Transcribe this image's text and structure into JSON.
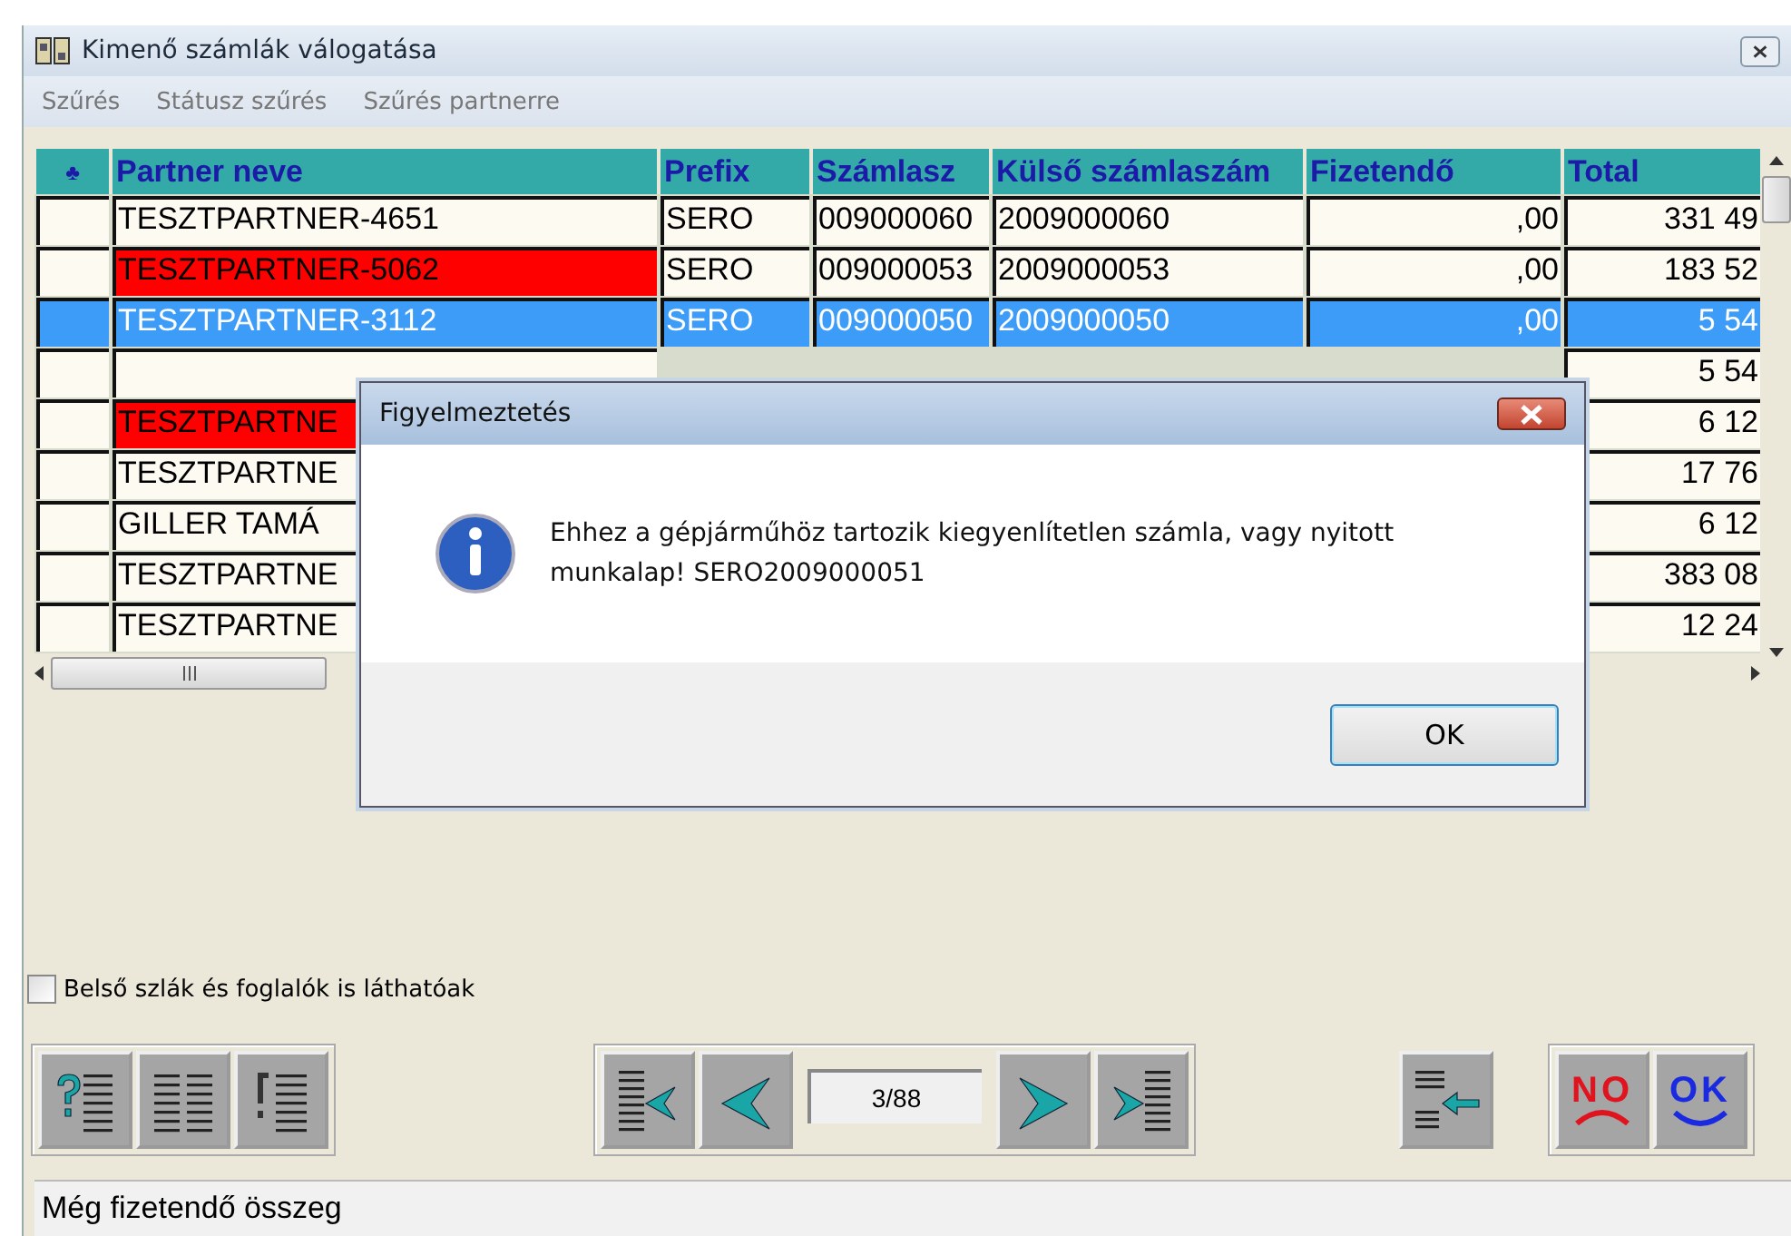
{
  "window": {
    "title": "Kimenő számlák válogatása"
  },
  "menu": [
    "Szűrés",
    "Státusz szűrés",
    "Szűrés partnerre"
  ],
  "table": {
    "columns": [
      "♣",
      "Partner neve",
      "Prefix",
      "Számlasz",
      "Külső számlaszám",
      "Fizetendő",
      "Total"
    ],
    "rows": [
      {
        "partner": "TESZTPARTNER-4651",
        "prefix": "SERO",
        "invoice_no": "009000060",
        "external_no": "2009000060",
        "payable": ",00",
        "total": "331 49",
        "flagged": false,
        "selected": false
      },
      {
        "partner": "TESZTPARTNER-5062",
        "prefix": "SERO",
        "invoice_no": "009000053",
        "external_no": "2009000053",
        "payable": ",00",
        "total": "183 52",
        "flagged": true,
        "selected": false
      },
      {
        "partner": "TESZTPARTNER-3112",
        "prefix": "SERO",
        "invoice_no": "009000050",
        "external_no": "2009000050",
        "payable": ",00",
        "total": "5 54",
        "flagged": false,
        "selected": true
      },
      {
        "total": "5 54",
        "flagged": false,
        "selected": false
      },
      {
        "partner": "TESZTPARTNE",
        "total": "6 12",
        "flagged": true,
        "selected": false
      },
      {
        "partner": "TESZTPARTNE",
        "total": "17 76",
        "flagged": false,
        "selected": false
      },
      {
        "partner": "GILLER TAMÁ",
        "total": "6 12",
        "flagged": false,
        "selected": false
      },
      {
        "partner": "TESZTPARTNE",
        "total": "383 08",
        "flagged": false,
        "selected": false
      },
      {
        "partner": "TESZTPARTNE",
        "total": "12 24",
        "flagged": false,
        "selected": false
      }
    ]
  },
  "checkbox": {
    "label": "Belső szlák és foglalók is láthatóak",
    "checked": false
  },
  "toolbar": {
    "filter_buttons": [
      {
        "kind": "help-list"
      },
      {
        "kind": "list"
      },
      {
        "kind": "exclaim-list"
      }
    ],
    "nav_buttons": [
      {
        "kind": "first"
      },
      {
        "kind": "prev"
      },
      {
        "kind": "counter",
        "text": "3/88"
      },
      {
        "kind": "next"
      },
      {
        "kind": "last"
      }
    ],
    "import_button": {
      "kind": "import"
    },
    "answer_buttons": [
      {
        "kind": "no",
        "label": "NO"
      },
      {
        "kind": "ok",
        "label": "OK"
      }
    ]
  },
  "status_bar": "Még fizetendő összeg",
  "dialog": {
    "title": "Figyelmeztetés",
    "message": "Ehhez a gépjárműhöz tartozik kiegyenlítetlen számla, vagy nyitott munkalap!   SERO2009000051",
    "button": "OK"
  }
}
